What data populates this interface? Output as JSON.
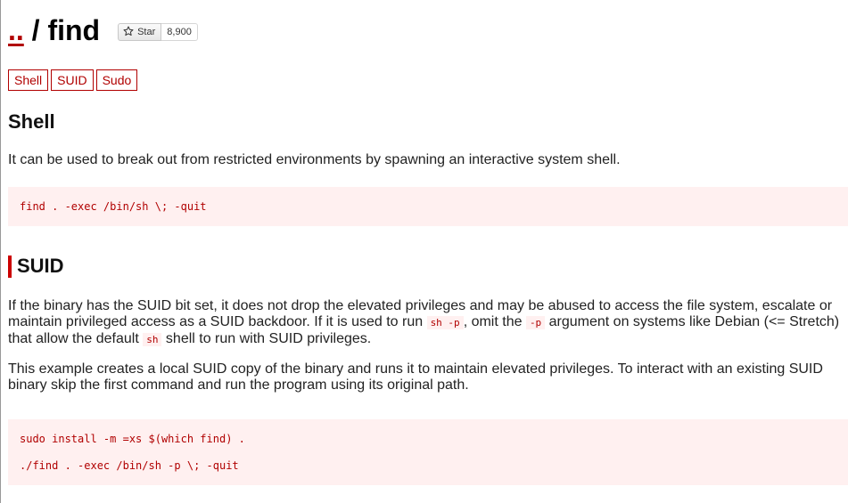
{
  "header": {
    "parent_link": "..",
    "separator": "/",
    "title": "find",
    "star": {
      "label": "Star",
      "count": "8,900",
      "icon": "star-icon"
    }
  },
  "tags": [
    "Shell",
    "SUID",
    "Sudo"
  ],
  "sections": {
    "shell": {
      "heading": "Shell",
      "description": "It can be used to break out from restricted environments by spawning an interactive system shell.",
      "code": [
        "find . -exec /bin/sh \\; -quit"
      ]
    },
    "suid": {
      "heading": "SUID",
      "para1_a": "If the binary has the SUID bit set, it does not drop the elevated privileges and may be abused to access the file system, escalate or maintain privileged access as a SUID backdoor. If it is used to run ",
      "para1_code1": "sh -p",
      "para1_b": ", omit the ",
      "para1_code2": "-p",
      "para1_c": " argument on systems like Debian (<= Stretch) that allow the default ",
      "para1_code3": "sh",
      "para1_d": " shell to run with SUID privileges.",
      "para2": "This example creates a local SUID copy of the binary and runs it to maintain elevated privileges. To interact with an existing SUID binary skip the first command and run the program using its original path.",
      "code": [
        "sudo install -m =xs $(which find) .",
        "./find . -exec /bin/sh -p \\; -quit"
      ]
    }
  },
  "colors": {
    "accent": "#b10000",
    "code_bg": "#fff0f0"
  }
}
